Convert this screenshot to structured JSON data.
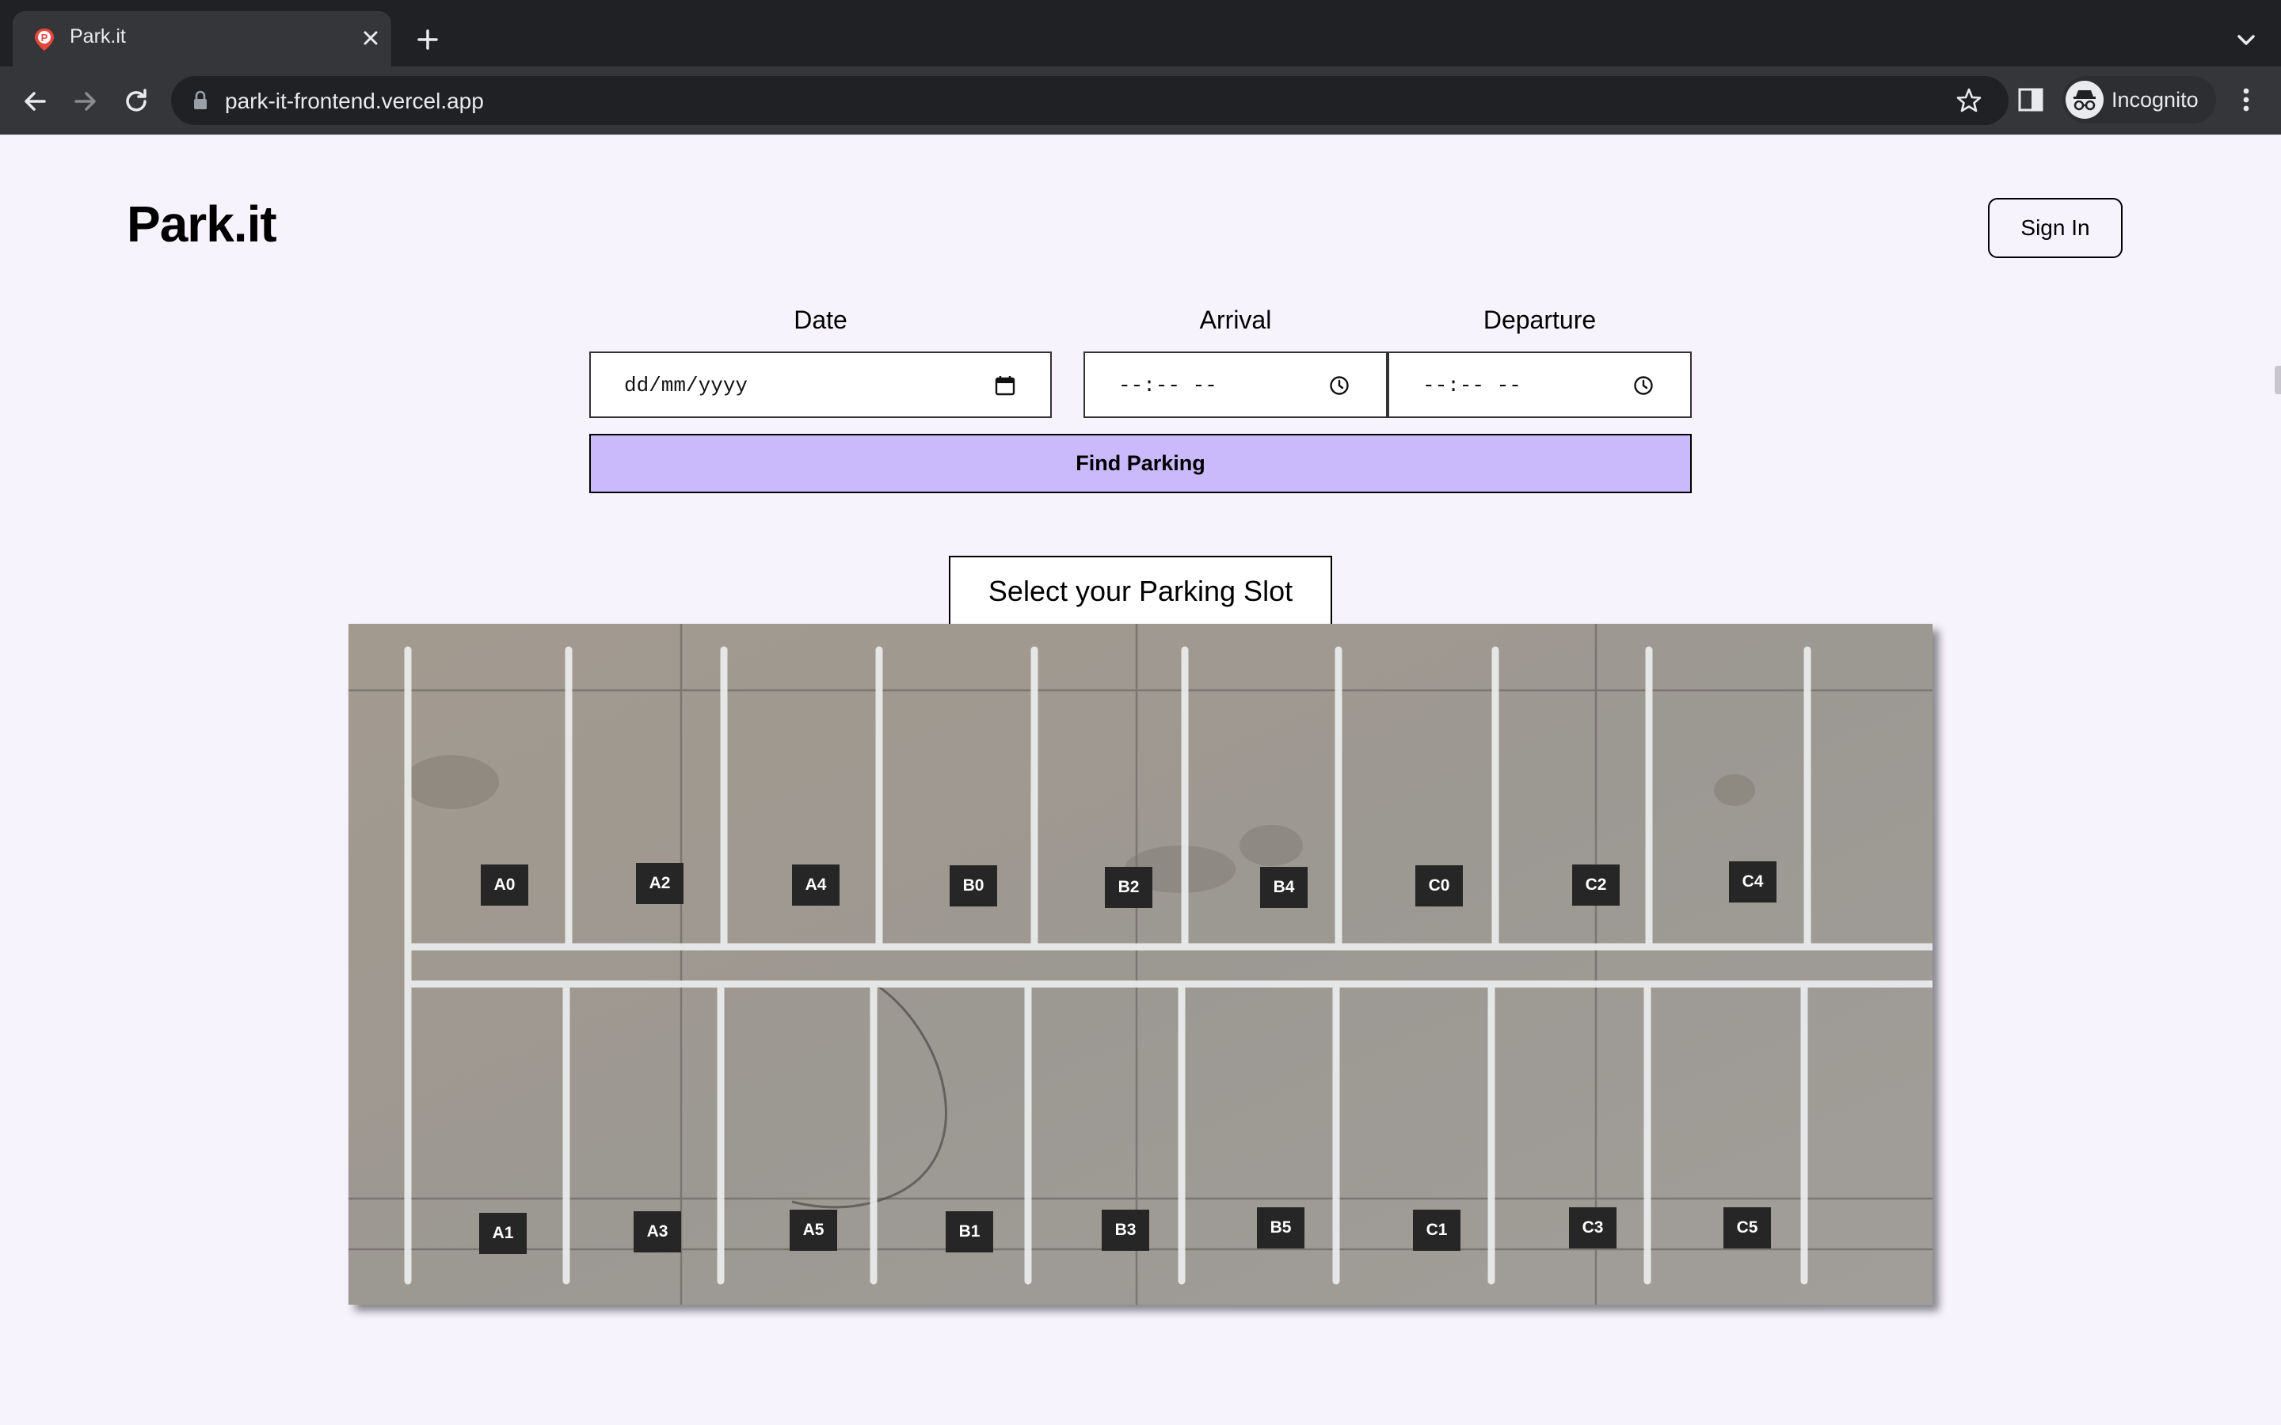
{
  "browser": {
    "tab_title": "Park.it",
    "url": "park-it-frontend.vercel.app",
    "profile_label": "Incognito"
  },
  "header": {
    "brand": "Park.it",
    "sign_in_label": "Sign In"
  },
  "search": {
    "date_label": "Date",
    "date_value": "dd/mm/yyyy",
    "arrival_label": "Arrival",
    "arrival_value": "--:-- --",
    "departure_label": "Departure",
    "departure_value": "--:-- --",
    "find_button": "Find Parking"
  },
  "lot": {
    "heading": "Select your Parking Slot",
    "top_row": [
      "A0",
      "A2",
      "A4",
      "B0",
      "B2",
      "B4",
      "C0",
      "C2",
      "C4"
    ],
    "bottom_row": [
      "A1",
      "A3",
      "A5",
      "B1",
      "B3",
      "B5",
      "C1",
      "C3",
      "C5"
    ]
  },
  "colors": {
    "page_background": "#f6f3fd",
    "find_button": "#cab9fb",
    "slot_badge": "#262626",
    "asphalt": "#9d9892"
  }
}
